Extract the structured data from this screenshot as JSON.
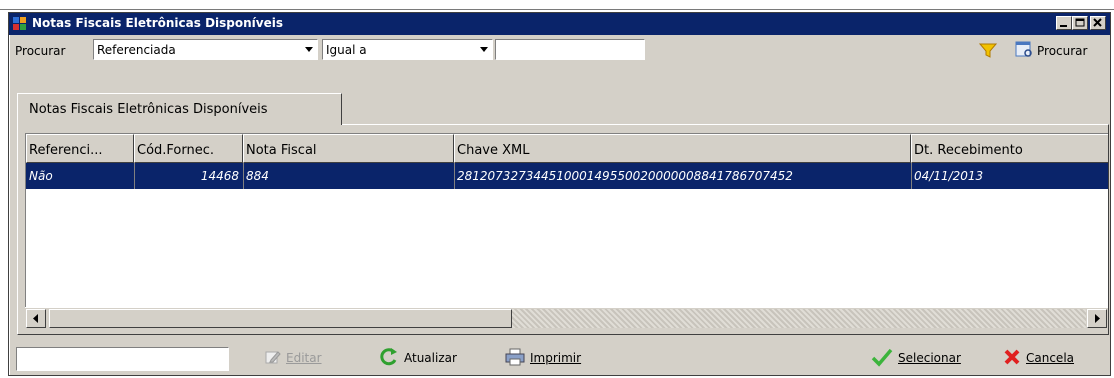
{
  "window": {
    "title": "Notas Fiscais Eletrônicas Disponíveis",
    "accent": "#0a246a"
  },
  "search": {
    "label": "Procurar",
    "field_value": "Referenciada",
    "operator_value": "Igual a",
    "text_value": "",
    "procurar_label": "Procurar"
  },
  "tab": {
    "label": "Notas Fiscais Eletrônicas Disponíveis"
  },
  "grid": {
    "columns": [
      "Referenci...",
      "Cód.Fornec.",
      "Nota Fiscal",
      "Chave XML",
      "Dt. Recebimento"
    ],
    "rows": [
      {
        "referenciada": "Não",
        "cod_fornec": "14468",
        "nota_fiscal": "884",
        "chave_xml": "28120732734451000149550020000008841786707452",
        "dt_recebimento": "04/11/2013"
      }
    ]
  },
  "buttons": {
    "editar": "Editar",
    "atualizar": "Atualizar",
    "imprimir": "Imprimir",
    "selecionar": "Selecionar",
    "cancela": "Cancela"
  }
}
